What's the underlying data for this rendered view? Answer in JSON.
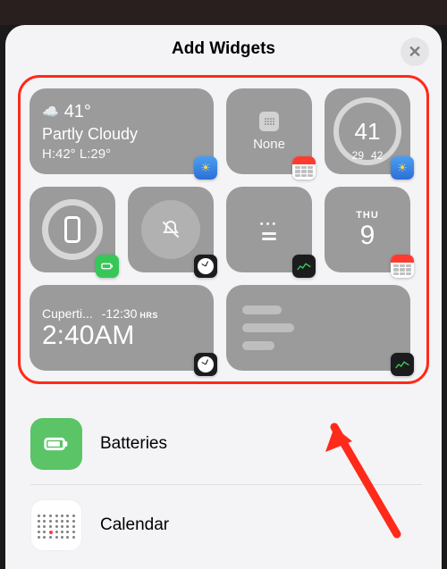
{
  "header": {
    "title": "Add Widgets",
    "close_glyph": "✕"
  },
  "widgets": {
    "weather_wide": {
      "temp": "41°",
      "condition": "Partly Cloudy",
      "hi_lo": "H:42° L:29°"
    },
    "calendar_none": {
      "label": "None"
    },
    "weather_gauge": {
      "value": "41",
      "low": "29",
      "high": "42"
    },
    "calendar_day": {
      "dow": "THU",
      "day": "9"
    },
    "clock_wide": {
      "city": "Cuperti...",
      "offset": "-12:30",
      "offset_unit": "HRS",
      "time": "2:40AM"
    }
  },
  "apps": {
    "batteries": {
      "label": "Batteries"
    },
    "calendar": {
      "label": "Calendar"
    }
  },
  "colors": {
    "highlight": "#ff2a1a",
    "widget_bg": "#9b9b9b",
    "battery_green": "#37c759"
  }
}
